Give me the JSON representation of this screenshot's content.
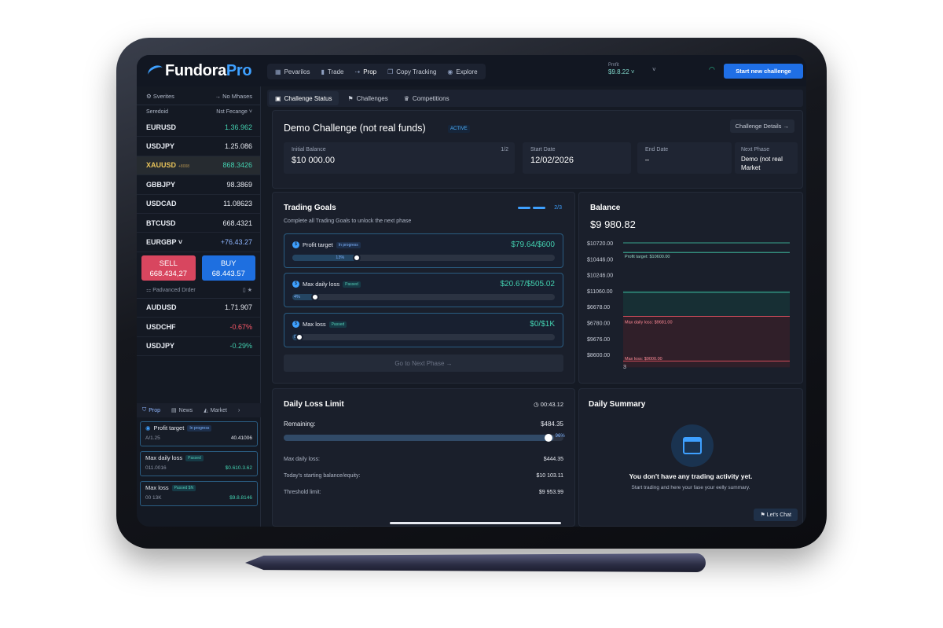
{
  "brand": {
    "name_a": "Fundora",
    "name_b": "Pro"
  },
  "nav": {
    "items": [
      {
        "label": "Pevarilos",
        "icon": "chart-icon"
      },
      {
        "label": "Trade",
        "icon": "bars-icon"
      },
      {
        "label": "Prop",
        "icon": "arrow-icon"
      },
      {
        "label": "Copy Tracking",
        "icon": "copy-icon"
      },
      {
        "label": "Explore",
        "icon": "compass-icon"
      }
    ]
  },
  "header": {
    "profit_label": "Pmfit",
    "profit_value": "$9.8.22",
    "start_button": "Start new challenge"
  },
  "sidebar": {
    "favorites_label": "Sverites",
    "phases_label": "No Mhases",
    "select_label": "Seredoid",
    "select_value": "Nst Fecange",
    "symbols_a": [
      {
        "name": "EURUSD",
        "value": "1.36.962",
        "dir": "up"
      },
      {
        "name": "USDJPY",
        "value": "1.25.086",
        "dir": "nt"
      },
      {
        "name": "XAUUSD",
        "badge": "+8008",
        "value": "868.3426",
        "dir": "up",
        "highlight": true
      },
      {
        "name": "GBBJPY",
        "value": "98.3869",
        "dir": "nt"
      },
      {
        "name": "USDCAD",
        "value": "11.08623",
        "dir": "nt"
      },
      {
        "name": "BTCUSD",
        "value": "668.4321",
        "dir": "nt"
      },
      {
        "name": "EURGBP ˅",
        "value": "+76.43.27",
        "dir": "bl"
      }
    ],
    "sell_label": "SELL",
    "sell_value": "668.434,27",
    "buy_label": "BUY",
    "buy_value": "68.443.57",
    "advanced_order": "Padvanced Drder",
    "symbols_b": [
      {
        "name": "AUDUSD",
        "value": "1.71.907",
        "dir": "nt"
      },
      {
        "name": "USDCHF",
        "value": "-0.67%",
        "dir": "dn"
      },
      {
        "name": "USDJPY",
        "value": "-0.29%",
        "dir": "up"
      }
    ],
    "bottom_tabs": [
      "Prop",
      "News",
      "Market"
    ],
    "mini_cards": [
      {
        "title": "Profit target",
        "tag": "In progress",
        "left": "A/1.25",
        "right": "40.41006"
      },
      {
        "title": "Max daily loss",
        "tag": "Passed",
        "left": "011.0016",
        "right": "$0.610.3.62"
      },
      {
        "title": "Max loss",
        "tag": "Passed $N",
        "left": "00 13K",
        "right": "$9.8.8146"
      }
    ]
  },
  "subtabs": [
    "Challenge Status",
    "Challenges",
    "Competitions"
  ],
  "challenge": {
    "title": "Demo Challenge (not real funds)",
    "status": "ACTIVE",
    "details_button": "Challenge Details →",
    "stats": [
      {
        "label": "Initial Balance",
        "value": "$10 000.00",
        "right": "1/2"
      },
      {
        "label": "Start Date",
        "value": "12/02/2026"
      },
      {
        "label": "End Date",
        "value": "–"
      },
      {
        "label": "Next Phase",
        "value": "Demo (not real Market"
      }
    ]
  },
  "goals": {
    "title": "Trading Goals",
    "subtitle": "Complete all Trading Goals to unlock the next phase",
    "progress": "2/3",
    "items": [
      {
        "title": "Profit target",
        "tag": "In progress",
        "value": "$79.64/$600",
        "pct_label": "13%",
        "fraction": 0.23
      },
      {
        "title": "Max daily loss",
        "tag": "Passed",
        "value": "$20.67/$505.02",
        "pct_label": "4%",
        "fraction": 0.07
      },
      {
        "title": "Max loss",
        "tag": "Passed",
        "value": "$0/$1K",
        "pct_label": "0%",
        "fraction": 0.0
      }
    ],
    "next_button": "Go to Next Phase →"
  },
  "balance": {
    "title": "Balance",
    "value": "$9 980.82",
    "chart_data": {
      "type": "line",
      "y_ticks": [
        "$10720.00",
        "$10446.00",
        "$10246.00",
        "$11060.00",
        "$6678.00",
        "$6780.00",
        "$9676.00",
        "$8600.00"
      ],
      "x_label": "3",
      "annotations": [
        "Profit target: $10600.00",
        "Max daily loss: $9681.00",
        "Max loss: $9000.00"
      ],
      "colors": {
        "profit": "#43d1b0",
        "loss": "#ff5a6a"
      }
    }
  },
  "daily_loss": {
    "title": "Daily Loss Limit",
    "timer": "00:43.12",
    "remaining_label": "Remaining:",
    "remaining_value": "$484.35",
    "pct_label": "96%",
    "fraction": 0.96,
    "rows": [
      {
        "label": "Max daily loss:",
        "value": "$444.35"
      },
      {
        "label": "Today's starting balance/equity:",
        "value": "$10 103.11"
      },
      {
        "label": "Threshold limit:",
        "value": "$9 953.99"
      }
    ]
  },
  "summary": {
    "title": "Daily Summary",
    "empty_title": "You don't have any trading activity yet.",
    "empty_sub": "Start trading and here your fase your eelly summary.",
    "chat_button": "Let's Chat"
  }
}
